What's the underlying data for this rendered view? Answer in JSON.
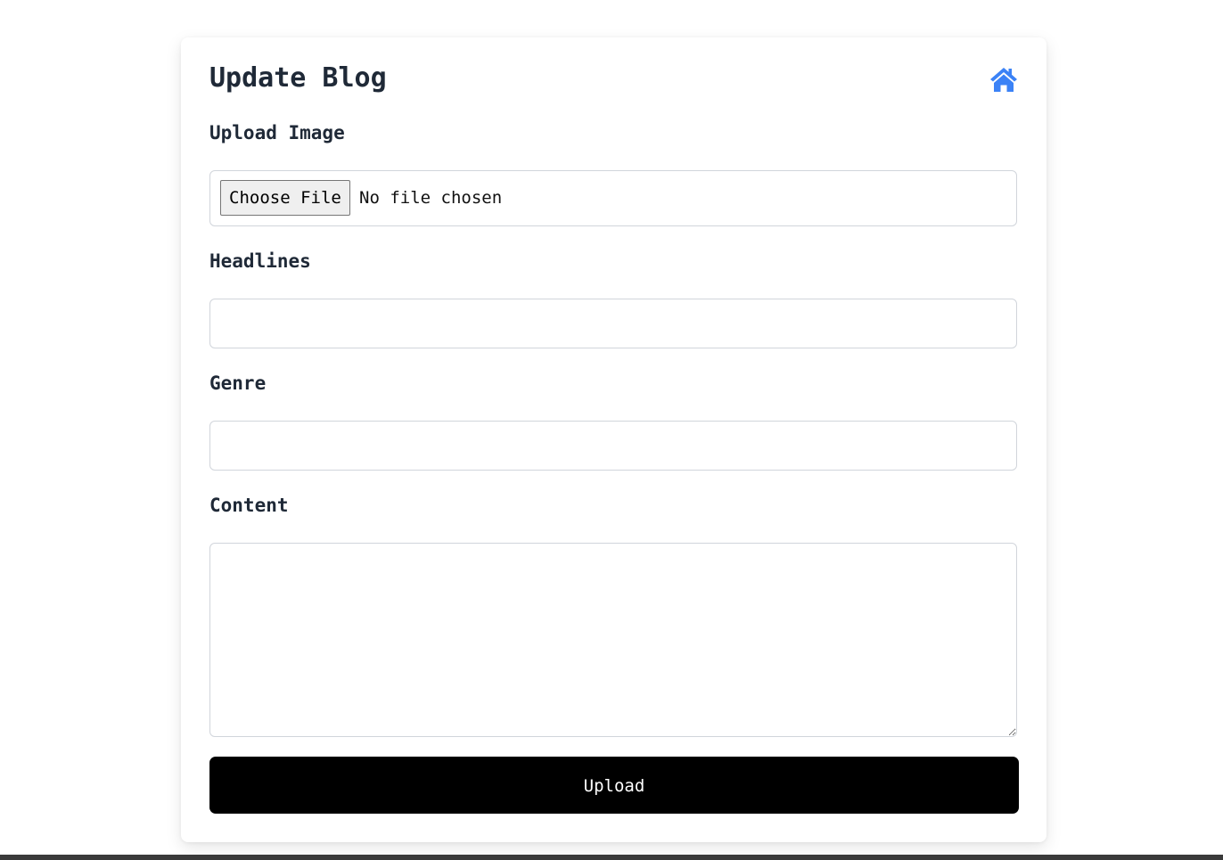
{
  "page": {
    "title": "Update Blog",
    "home_icon": "home-icon",
    "accent_color": "#3b82f6"
  },
  "form": {
    "image": {
      "label": "Upload Image",
      "button_label": "Choose File",
      "status": "No file chosen"
    },
    "headlines": {
      "label": "Headlines",
      "value": ""
    },
    "genre": {
      "label": "Genre",
      "value": ""
    },
    "content": {
      "label": "Content",
      "value": ""
    },
    "submit_label": "Upload"
  }
}
